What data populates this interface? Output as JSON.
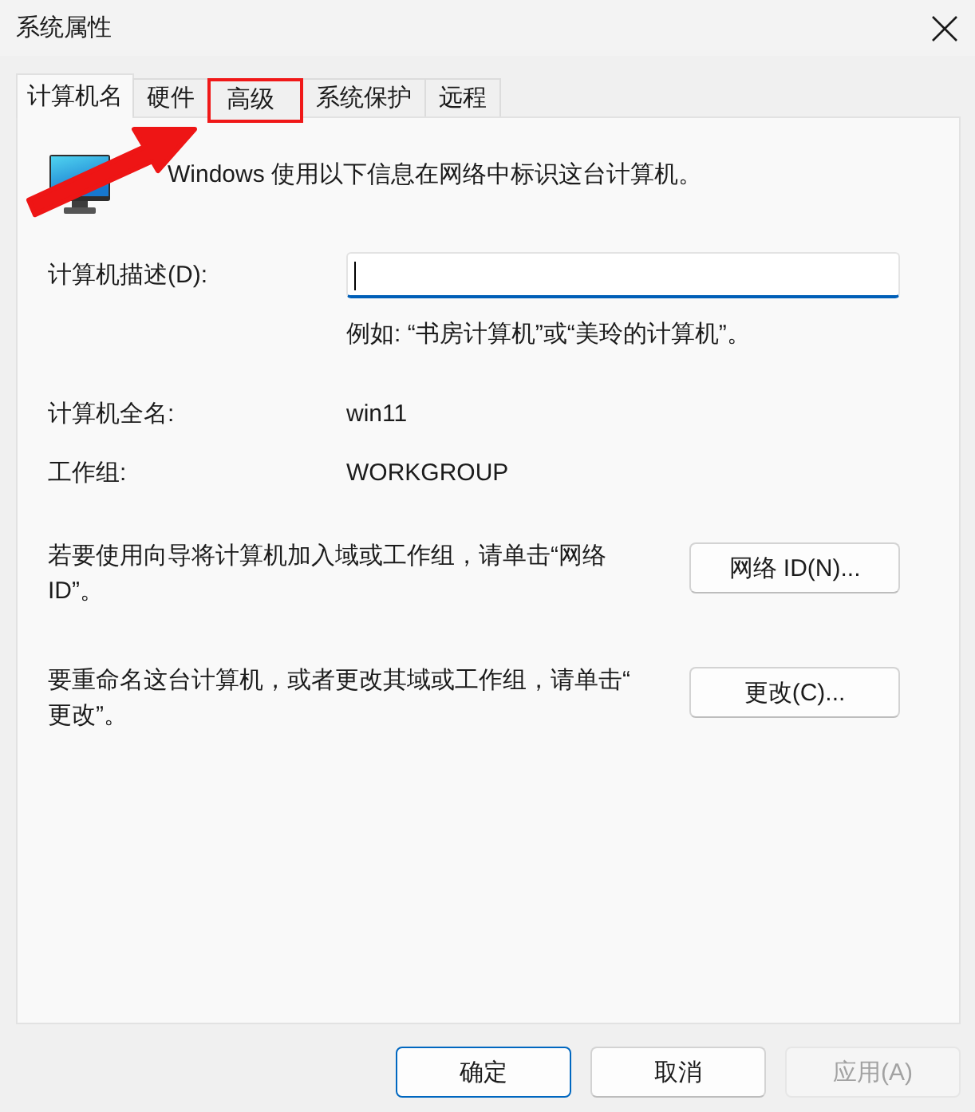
{
  "window": {
    "title": "系统属性"
  },
  "tabs": [
    {
      "label": "计算机名",
      "selected": true,
      "highlighted": false
    },
    {
      "label": "硬件",
      "selected": false,
      "highlighted": false
    },
    {
      "label": "高级",
      "selected": false,
      "highlighted": true
    },
    {
      "label": "系统保护",
      "selected": false,
      "highlighted": false
    },
    {
      "label": "远程",
      "selected": false,
      "highlighted": false
    }
  ],
  "intro": "Windows 使用以下信息在网络中标识这台计算机。",
  "description_field": {
    "label": "计算机描述(D):",
    "focused": true
  },
  "hint": "例如: “书房计算机”或“美玲的计算机”。",
  "info_rows": [
    {
      "label": "计算机全名:",
      "value": "win11"
    },
    {
      "label": "工作组:",
      "value": "WORKGROUP"
    }
  ],
  "actions": [
    {
      "text": "若要使用向导将计算机加入域或工作组，请单击“网络ID”。",
      "button": "网络 ID(N)..."
    },
    {
      "text": "要重命名这台计算机，或者更改其域或工作组，请单击“更改”。",
      "button": "更改(C)..."
    }
  ],
  "buttons": [
    {
      "label": "确定",
      "default": true,
      "disabled": false
    },
    {
      "label": "取消",
      "default": false,
      "disabled": false
    },
    {
      "label": "应用(A)",
      "default": false,
      "disabled": true
    }
  ]
}
